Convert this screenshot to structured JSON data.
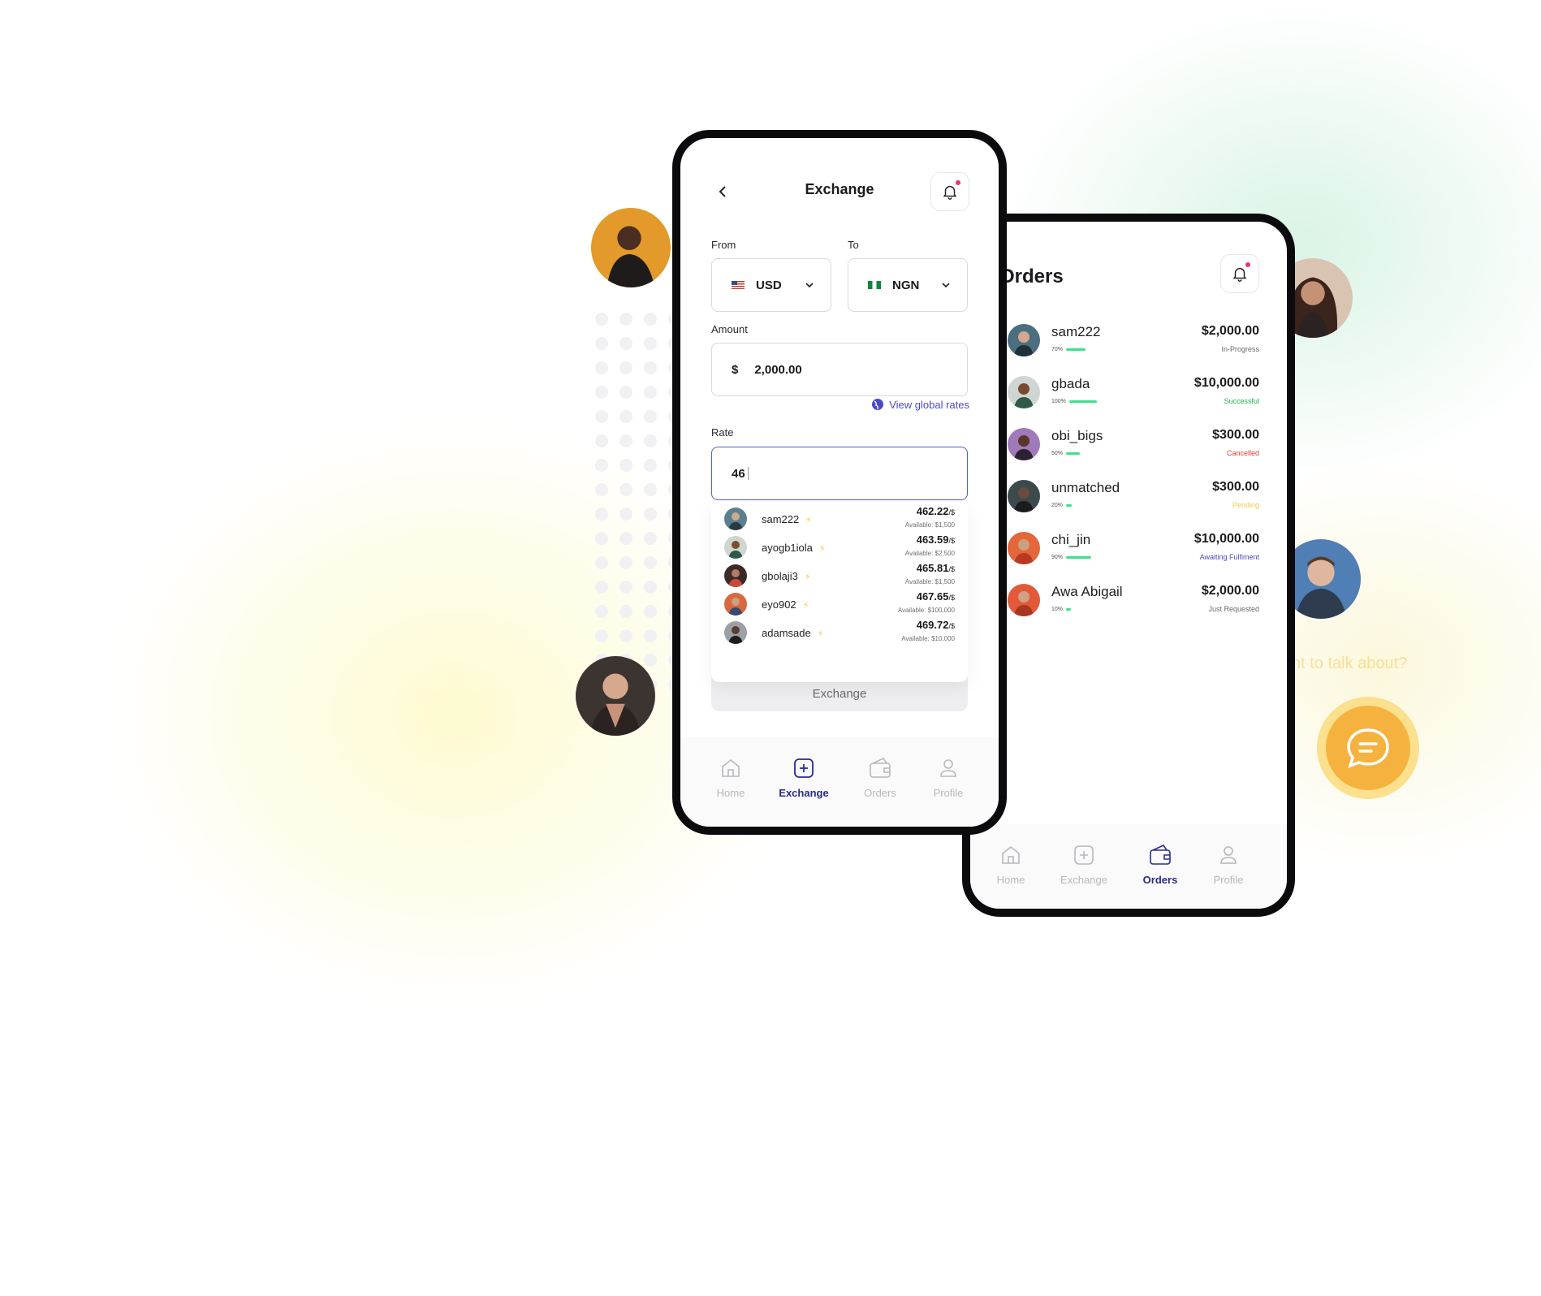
{
  "exchange": {
    "title": "Exchange",
    "from_label": "From",
    "to_label": "To",
    "from_currency": "USD",
    "to_currency": "NGN",
    "amount_label": "Amount",
    "currency_symbol": "$",
    "amount_value": "2,000.00",
    "global_rates_link": "View global rates",
    "rate_label": "Rate",
    "rate_value": "46",
    "exchange_button": "Exchange",
    "offers": [
      {
        "user": "sam222",
        "rate": "462.22",
        "unit": "/$",
        "available": "Available: $1,500"
      },
      {
        "user": "ayogb1iola",
        "rate": "463.59",
        "unit": "/$",
        "available": "Available: $2,500"
      },
      {
        "user": "gbolaji3",
        "rate": "465.81",
        "unit": "/$",
        "available": "Available: $1,500"
      },
      {
        "user": "eyo902",
        "rate": "467.65",
        "unit": "/$",
        "available": "Available: $100,000"
      },
      {
        "user": "adamsade",
        "rate": "469.72",
        "unit": "/$",
        "available": "Available: $10,000"
      }
    ],
    "tabs": [
      "Home",
      "Exchange",
      "Orders",
      "Profile"
    ],
    "active_tab": "Exchange"
  },
  "orders": {
    "title": "Orders",
    "items": [
      {
        "user": "sam222",
        "percent": "70%",
        "progress": 0.7,
        "amount": "$2,000.00",
        "status": "In-Progress",
        "status_color": "#6a6a72"
      },
      {
        "user": "gbada",
        "percent": "100%",
        "progress": 1.0,
        "amount": "$10,000.00",
        "status": "Successful",
        "status_color": "#22b14c"
      },
      {
        "user": "obi_bigs",
        "percent": "50%",
        "progress": 0.5,
        "amount": "$300.00",
        "status": "Cancelled",
        "status_color": "#e53935"
      },
      {
        "user": "unmatched",
        "percent": "20%",
        "progress": 0.2,
        "amount": "$300.00",
        "status": "Pending",
        "status_color": "#f3c94a"
      },
      {
        "user": "chi_jin",
        "percent": "90%",
        "progress": 0.9,
        "amount": "$10,000.00",
        "status": "Awaiting Fulfiment",
        "status_color": "#4b4bc9"
      },
      {
        "user": "Awa Abigail",
        "percent": "10%",
        "progress": 0.1,
        "amount": "$2,000.00",
        "status": "Just Requested",
        "status_color": "#6a6a72"
      }
    ],
    "tabs": [
      "Home",
      "Exchange",
      "Orders",
      "Profile"
    ],
    "active_tab": "Orders"
  },
  "chat": {
    "prompt_fragment": "nt to talk about?"
  },
  "colors": {
    "accent": "#2b2a8f",
    "link": "#4b4bc9",
    "progress": "#3ee08a",
    "chat": "#f6b23e"
  }
}
